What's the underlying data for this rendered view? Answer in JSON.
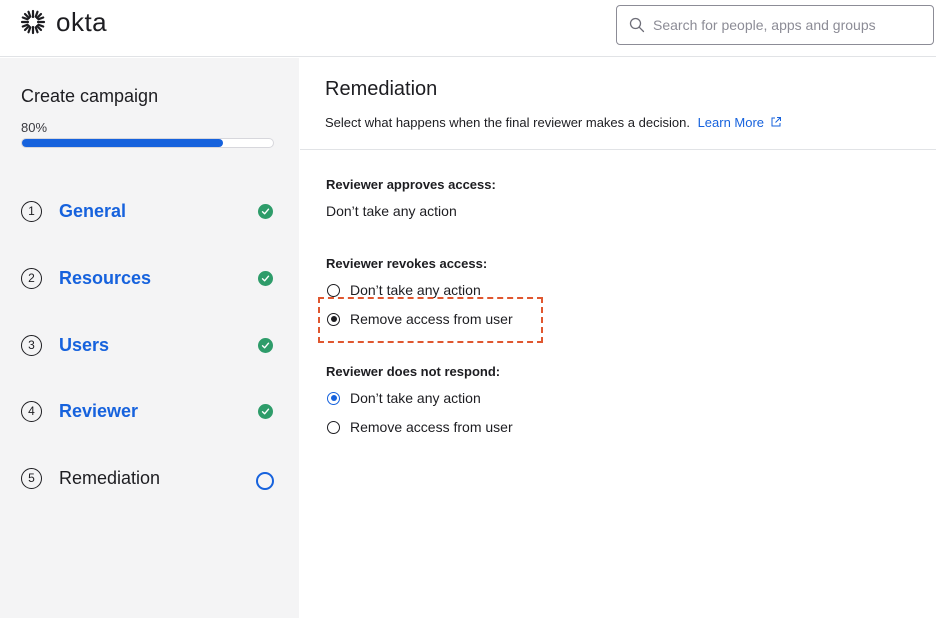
{
  "header": {
    "logo_text": "okta",
    "search_placeholder": "Search for people, apps and groups"
  },
  "sidebar": {
    "title": "Create campaign",
    "progress_text": "80%",
    "progress_value": 0.8,
    "steps": [
      {
        "number": "1",
        "label": "General",
        "status": "complete"
      },
      {
        "number": "2",
        "label": "Resources",
        "status": "complete"
      },
      {
        "number": "3",
        "label": "Users",
        "status": "complete"
      },
      {
        "number": "4",
        "label": "Reviewer",
        "status": "complete"
      },
      {
        "number": "5",
        "label": "Remediation",
        "status": "current"
      }
    ]
  },
  "main": {
    "title": "Remediation",
    "description": "Select what happens when the final reviewer makes a decision.",
    "learn_more": "Learn More",
    "approves": {
      "label": "Reviewer approves access:",
      "value": "Don’t take any action"
    },
    "revokes": {
      "label": "Reviewer revokes access:",
      "options": [
        "Don’t take any action",
        "Remove access from user"
      ],
      "selected": "Remove access from user"
    },
    "no_response": {
      "label": "Reviewer does not respond:",
      "options": [
        "Don’t take any action",
        "Remove access from user"
      ],
      "selected": "Don’t take any action"
    }
  },
  "colors": {
    "accent": "#1662dd",
    "success": "#2e9c6a",
    "highlight": "#e0572f"
  }
}
